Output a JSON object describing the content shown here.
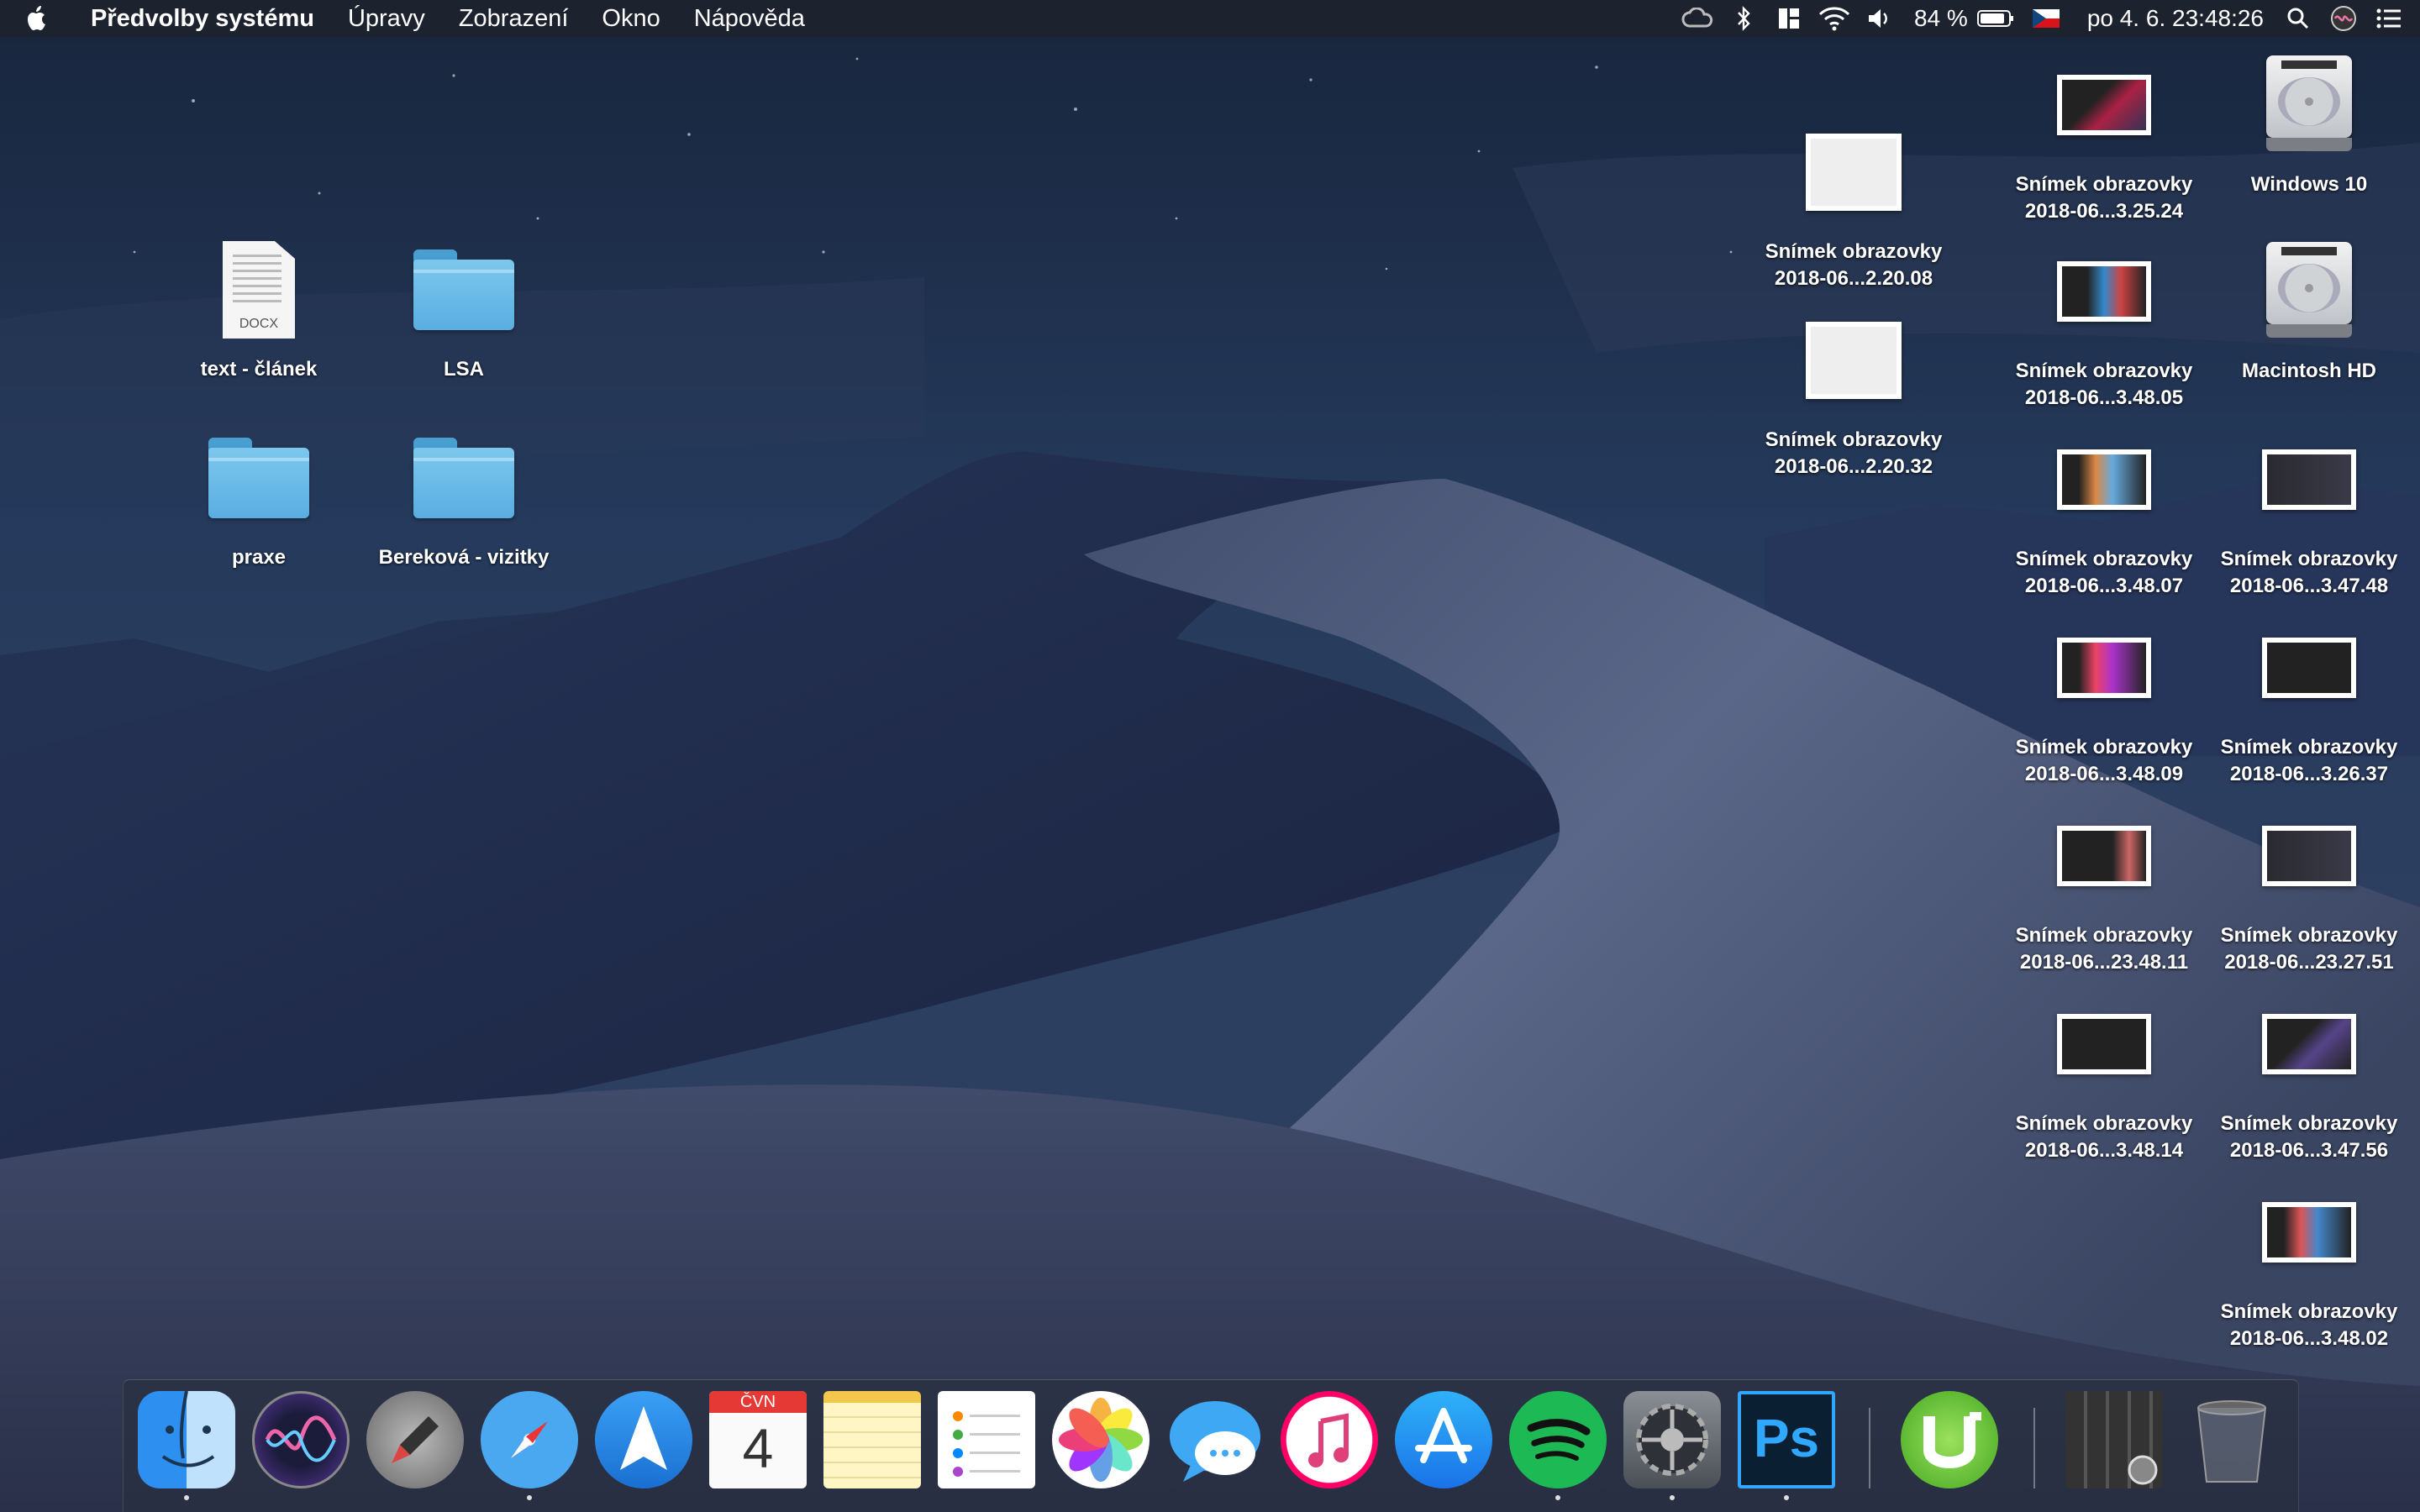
{
  "menubar": {
    "app_name": "Předvolby systému",
    "menus": [
      "Úpravy",
      "Zobrazení",
      "Okno",
      "Nápověda"
    ],
    "status_icons": [
      "creative-cloud-icon",
      "bluetooth-icon",
      "layout-icon",
      "wifi-icon",
      "volume-icon"
    ],
    "battery_percent": "84 %",
    "input_source": "czech-flag-icon",
    "clock": "po 4. 6.  23:48:26",
    "right_icons": [
      "spotlight-icon",
      "siri-icon",
      "notification-center-icon"
    ]
  },
  "desktop_icons": {
    "text_clanek": {
      "label": "text - článek",
      "ext": "DOCX"
    },
    "lsa": {
      "label": "LSA"
    },
    "praxe": {
      "label": "praxe"
    },
    "berekova": {
      "label": "Bereková - vizitky"
    },
    "shot_22008": {
      "line1": "Snímek obrazovky",
      "line2": "2018-06...2.20.08"
    },
    "shot_22032": {
      "line1": "Snímek obrazovky",
      "line2": "2018-06...2.20.32"
    },
    "shot_32524": {
      "line1": "Snímek obrazovky",
      "line2": "2018-06...3.25.24"
    },
    "shot_34805": {
      "line1": "Snímek obrazovky",
      "line2": "2018-06...3.48.05"
    },
    "shot_34807": {
      "line1": "Snímek obrazovky",
      "line2": "2018-06...3.48.07"
    },
    "shot_34809": {
      "line1": "Snímek obrazovky",
      "line2": "2018-06...3.48.09"
    },
    "shot_234811": {
      "line1": "Snímek obrazovky",
      "line2": "2018-06...23.48.11"
    },
    "shot_34814": {
      "line1": "Snímek obrazovky",
      "line2": "2018-06...3.48.14"
    },
    "windows10": {
      "label": "Windows 10"
    },
    "macintosh_hd": {
      "label": "Macintosh HD"
    },
    "shot_34748": {
      "line1": "Snímek obrazovky",
      "line2": "2018-06...3.47.48"
    },
    "shot_32637": {
      "line1": "Snímek obrazovky",
      "line2": "2018-06...3.26.37"
    },
    "shot_232751": {
      "line1": "Snímek obrazovky",
      "line2": "2018-06...23.27.51"
    },
    "shot_34756": {
      "line1": "Snímek obrazovky",
      "line2": "2018-06...3.47.56"
    },
    "shot_34802": {
      "line1": "Snímek obrazovky",
      "line2": "2018-06...3.48.02"
    }
  },
  "dock": {
    "apps": [
      "finder-icon",
      "siri-icon",
      "launchpad-icon",
      "safari-icon",
      "spark-icon",
      "calendar-icon",
      "notes-icon",
      "reminders-icon",
      "photos-icon",
      "messages-icon",
      "itunes-icon",
      "app-store-icon",
      "spotify-icon",
      "system-preferences-icon",
      "photoshop-icon",
      "utorrent-icon",
      "downloads-stack-icon",
      "trash-icon"
    ],
    "calendar_month": "ČVN",
    "calendar_day": "4",
    "photoshop_label": "Ps"
  },
  "colors": {
    "menubar": "#1e222c",
    "folder": "#6bbbe8",
    "dune": "#3a4560",
    "sky": "#1f3150"
  }
}
